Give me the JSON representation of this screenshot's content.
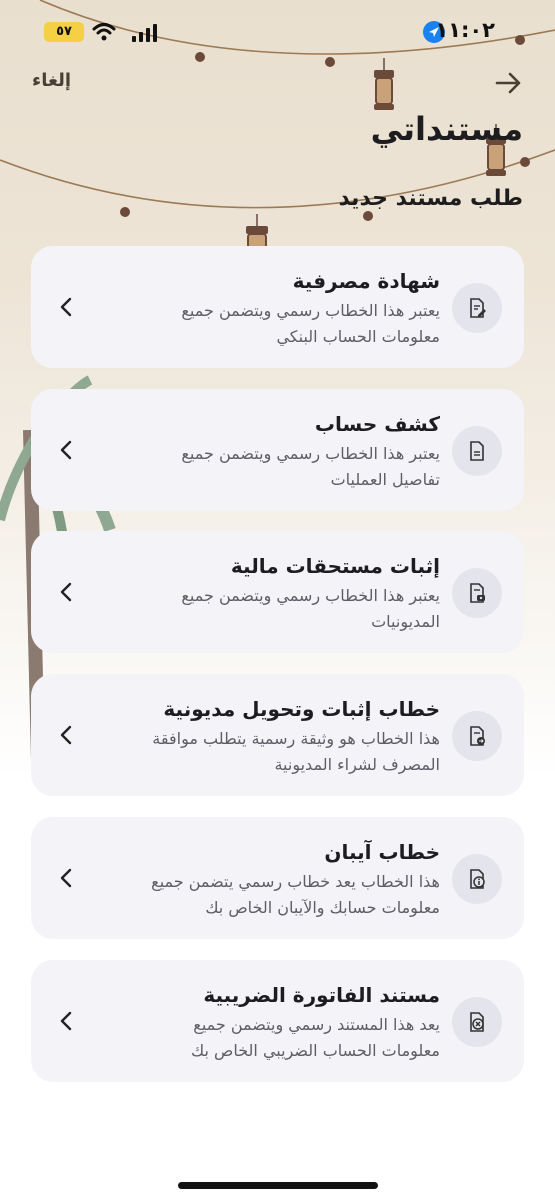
{
  "status_bar": {
    "time": "١١:٠٢",
    "battery": "٥٧"
  },
  "nav": {
    "cancel_label": "إلغاء"
  },
  "page": {
    "title": "مستنداتي",
    "section_title": "طلب مستند جديد"
  },
  "documents": [
    {
      "title": "شهادة مصرفية",
      "description_line1": "يعتبر هذا الخطاب رسمي ويتضمن جميع",
      "description_line2": "معلومات الحساب البنكي",
      "icon": "document-edit-icon"
    },
    {
      "title": "كشف حساب",
      "description_line1": "يعتبر هذا الخطاب رسمي ويتضمن جميع",
      "description_line2": "تفاصيل العمليات",
      "icon": "document-icon"
    },
    {
      "title": "إثبات مستحقات مالية",
      "description_line1": "يعتبر هذا الخطاب رسمي ويتضمن جميع",
      "description_line2": "المديونيات",
      "icon": "document-money-icon"
    },
    {
      "title": "خطاب إثبات وتحويل مديونية",
      "description_line1": "هذا الخطاب هو وثيقة رسمية يتطلب موافقة",
      "description_line2": "المصرف لشراء المديونية",
      "icon": "document-transfer-icon"
    },
    {
      "title": "خطاب آيبان",
      "description_line1": "هذا الخطاب يعد خطاب رسمي يتضمن جميع",
      "description_line2": "معلومات حسابك والآيبان الخاص بك",
      "icon": "document-info-icon"
    },
    {
      "title": "مستند الفاتورة الضريبية",
      "description_line1": "يعد هذا المستند رسمي ويتضمن جميع",
      "description_line2": "معلومات الحساب الضريبي الخاص بك",
      "icon": "document-tax-icon"
    }
  ],
  "colors": {
    "background_warm": "#e9dfcf",
    "card": "#f4f4f8",
    "icon_circle": "#e4e4ec",
    "text_dark": "#1d1d1f",
    "text_muted": "#5d5d66"
  }
}
